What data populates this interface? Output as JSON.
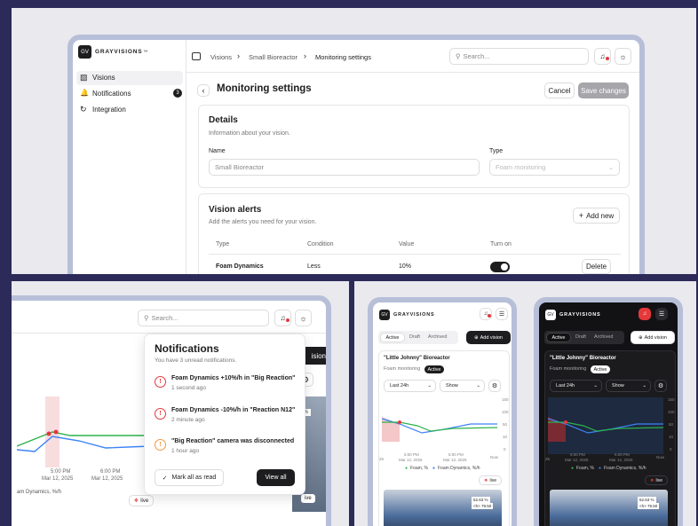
{
  "brand": {
    "wordmark": "GRAYVISIONS",
    "tm": "™",
    "mark": "GV"
  },
  "top": {
    "sidebar": [
      {
        "label": "Visions",
        "icon": "bar-chart-icon"
      },
      {
        "label": "Notifications",
        "icon": "bell-icon",
        "badge": "3"
      },
      {
        "label": "Integration",
        "icon": "sync-icon"
      }
    ],
    "breadcrumb": [
      "Visions",
      "Small Bioreactor",
      "Monitoring settings"
    ],
    "search_placeholder": "Search...",
    "page_title": "Monitoring settings",
    "cancel_label": "Cancel",
    "save_label": "Save changes",
    "details": {
      "title": "Details",
      "subtitle": "Information about your vision.",
      "name_label": "Name",
      "name_value": "Small Bioreactor",
      "type_label": "Type",
      "type_value": "Foam monitoring"
    },
    "alerts": {
      "title": "Vision alerts",
      "subtitle": "Add the alerts you need for your vision.",
      "add_label": "Add new",
      "columns": [
        "Type",
        "Condition",
        "Value",
        "Turn on"
      ],
      "rows": [
        {
          "type": "Foam Dynamics",
          "condition": "Less",
          "value": "10%",
          "action": "Delete"
        }
      ]
    }
  },
  "notif": {
    "search_placeholder": "Search...",
    "title": "Notifications",
    "subtitle": "You have 3 unread notifications.",
    "items": [
      {
        "text": "Foam Dynamics +10%/h in \"Big Reaction\"",
        "time": "1 second ago",
        "kind": "alert"
      },
      {
        "text": "Foam Dynamics -10%/h in \"Reaction N12\"",
        "time": "2 minute ago",
        "kind": "alert"
      },
      {
        "text": "\"Big Reaction\" camera was disconnected",
        "time": "1 hour ago",
        "kind": "warning"
      }
    ],
    "mark_all": "Mark all as read",
    "view_all": "View all",
    "bg_x_ticks": [
      {
        "time": "5:00 PM",
        "date": "Mar 12, 2025"
      },
      {
        "time": "6:00 PM",
        "date": "Mar 12, 2025"
      }
    ],
    "bg_legend": "am Dynamics, %/h",
    "bg_btn_partial": "ision",
    "bg_badge_partial": "6%",
    "bg_live_partial": "ive",
    "bg_live": "live"
  },
  "mobile": {
    "tabs": [
      "Active",
      "Draft",
      "Archived"
    ],
    "add_vision": "Add vision",
    "card_title": "\"Little Johnny\" Bioreactor",
    "card_type": "Foam monitoring",
    "card_status": "Active",
    "range": "Last 24h",
    "show": "Show",
    "y_ticks": [
      "150",
      "100",
      "50",
      "10",
      "0"
    ],
    "x_ticks": [
      {
        "time": "5:00 PM",
        "date": "Mar 12, 2025"
      },
      {
        "time": "6:00 PM",
        "date": "Mar 12, 2025"
      },
      {
        "time": "Now",
        "date": ""
      }
    ],
    "x_partial": "25",
    "legend": [
      "Foam, %",
      "Foam Dynamics, %/h"
    ],
    "live": "live",
    "photo_label_1": "52.63 %",
    "photo_label_2": "<h> 79.50"
  },
  "colors": {
    "foam": "#2bb24c",
    "dynamics": "#3b82f6",
    "alert": "#e5383b",
    "warning": "#f09a3e"
  }
}
